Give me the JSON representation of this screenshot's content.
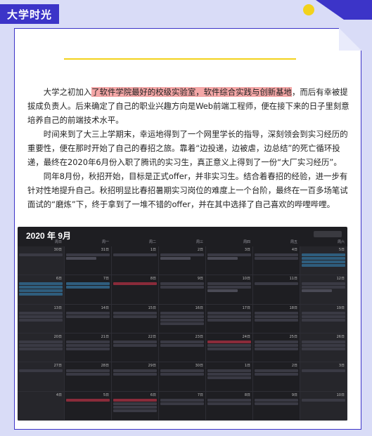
{
  "header": {
    "title": "大学时光"
  },
  "paragraphs": {
    "p1_pre": "大学之初加入",
    "p1_hl": "了软件学院最好的校级实验室，软件综合实践与创新基地",
    "p1_post": "，而后有幸被提拔成负责人。后来确定了自己的职业兴趣方向是Web前端工程师，便在接下来的日子里刻意培养自己的前端技术水平。",
    "p2": "时间来到了大三上学期末，幸运地得到了一个网里学长的指导，深刻领会到实习经历的重要性，便在那时开始了自己的春招之旅。靠着“边投递，边被虐，边总结”的死亡循环投递，最终在2020年6月份入职了腾讯的实习生，真正意义上得到了一份“大厂实习经历”。",
    "p3": "同年8月份，秋招开始，目标是正式offer，并非实习生。结合着春招的经验，进一步有针对性地提升自己。秋招明显比春招暑期实习岗位的难度上一个台阶，最终在一百多场笔试面试的“磨炼”下，终于拿到了一堆不错的offer，并在其中选择了自己喜欢的哔哩哔哩。"
  },
  "calendar": {
    "title": "2020 年 9月",
    "weekdays": [
      "周日",
      "周一",
      "周二",
      "周三",
      "周四",
      "周五",
      "周六"
    ],
    "days": [
      "30日",
      "31日",
      "1日",
      "2日",
      "3日",
      "4日",
      "5日",
      "6日",
      "7日",
      "8日",
      "9日",
      "10日",
      "11日",
      "12日",
      "13日",
      "14日",
      "15日",
      "16日",
      "17日",
      "18日",
      "19日",
      "20日",
      "21日",
      "22日",
      "23日",
      "24日",
      "25日",
      "26日",
      "27日",
      "28日",
      "29日",
      "30日",
      "1日",
      "2日",
      "3日",
      "4日",
      "5日",
      "6日",
      "7日",
      "8日",
      "9日",
      "10日"
    ]
  }
}
